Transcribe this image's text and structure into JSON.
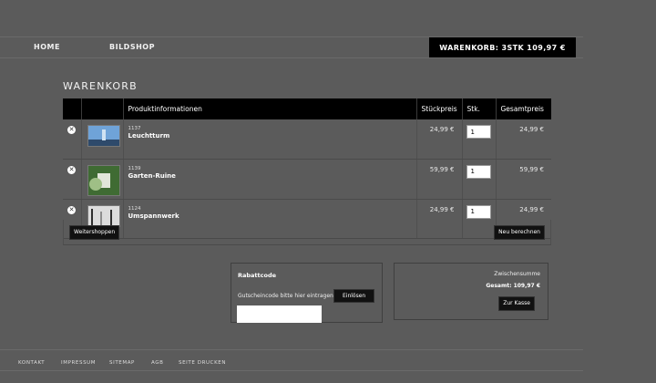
{
  "nav": {
    "home": "HOME",
    "shop": "BILDSHOP",
    "cart_summary": "WARENKORB: 3STK 109,97 €"
  },
  "page": {
    "title": "WARENKORB"
  },
  "table": {
    "headers": [
      "",
      "",
      "Produktinformationen",
      "Stückpreis",
      "Stk.",
      "Gesamtpreis"
    ],
    "rows": [
      {
        "sku": "1137",
        "name": "Leuchtturm",
        "unit_price": "24,99 €",
        "qty": "1",
        "total": "24,99 €",
        "thumb_colors": [
          "#6fa3d8",
          "#cfe2f2",
          "#2e4a6b"
        ]
      },
      {
        "sku": "1139",
        "name": "Garten-Ruine",
        "unit_price": "59,99 €",
        "qty": "1",
        "total": "59,99 €",
        "thumb_colors": [
          "#3f6b33",
          "#9fbf86",
          "#e2e6da"
        ]
      },
      {
        "sku": "1124",
        "name": "Umspannwerk",
        "unit_price": "24,99 €",
        "qty": "1",
        "total": "24,99 €",
        "thumb_colors": [
          "#dcdcdc",
          "#8d8d8d",
          "#2f2f2f"
        ]
      }
    ],
    "continue_button": "Weitershoppen",
    "recalc_button": "Neu berechnen"
  },
  "coupon": {
    "title": "Rabattcode",
    "hint": "Gutscheincode bitte hier eintragen",
    "redeem_button": "Einlösen",
    "input_value": ""
  },
  "totals": {
    "subtotal_label": "Zwischensumme",
    "total_label": "Gesamt: 109,97 €",
    "checkout_button": "Zur Kasse"
  },
  "footer": {
    "links": [
      "KONTAKT",
      "IMPRESSUM",
      "SITEMAP",
      "AGB",
      "SEITE DRUCKEN"
    ]
  }
}
